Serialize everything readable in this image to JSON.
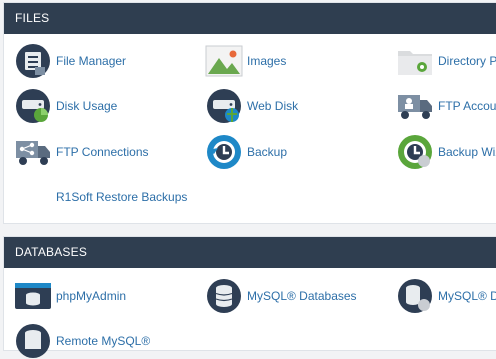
{
  "files": {
    "header": "FILES",
    "items": [
      {
        "label": "File Manager",
        "icon": "file-manager-icon"
      },
      {
        "label": "Images",
        "icon": "images-icon"
      },
      {
        "label": "Directory Pr",
        "icon": "directory-privacy-icon"
      },
      {
        "label": "Disk Usage",
        "icon": "disk-usage-icon"
      },
      {
        "label": "Web Disk",
        "icon": "web-disk-icon"
      },
      {
        "label": "FTP Accoun",
        "icon": "ftp-accounts-icon"
      },
      {
        "label": "FTP Connections",
        "icon": "ftp-connections-icon"
      },
      {
        "label": "Backup",
        "icon": "backup-icon"
      },
      {
        "label": "Backup Wiz",
        "icon": "backup-wizard-icon"
      },
      {
        "label": "R1Soft Restore Backups",
        "icon": ""
      }
    ]
  },
  "databases": {
    "header": "DATABASES",
    "items": [
      {
        "label": "phpMyAdmin",
        "icon": "phpmyadmin-icon"
      },
      {
        "label": "MySQL® Databases",
        "icon": "mysql-databases-icon"
      },
      {
        "label": "MySQL® Da",
        "icon": "mysql-database-wizard-icon"
      },
      {
        "label": "Remote MySQL®",
        "icon": "remote-mysql-icon"
      }
    ]
  },
  "colors": {
    "header_bg": "#2f3e50",
    "link": "#2d6fa8",
    "navy": "#2e3e54",
    "green": "#5aa63b",
    "blue": "#1e88c7"
  }
}
